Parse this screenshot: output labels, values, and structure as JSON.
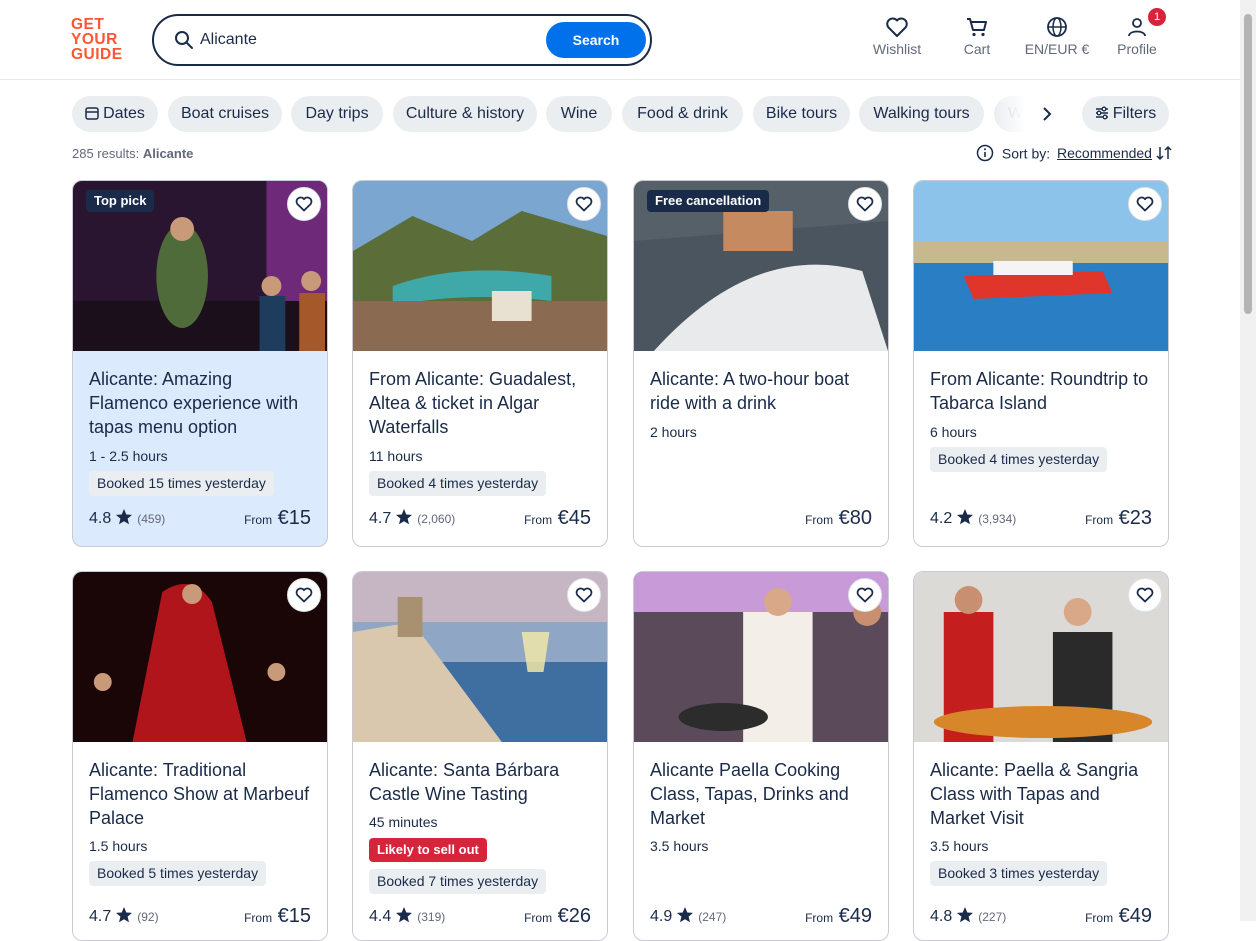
{
  "brand": {
    "line1": "GET",
    "line2": "YOUR",
    "line3": "GUIDE",
    "color": "#ff5533"
  },
  "search": {
    "value": "Alicante",
    "placeholder": "Search",
    "button": "Search"
  },
  "nav": {
    "wishlist": "Wishlist",
    "cart": "Cart",
    "lang": "EN/EUR €",
    "profile": "Profile",
    "profile_badge": "1"
  },
  "chips": [
    "Dates",
    "Boat cruises",
    "Day trips",
    "Culture & history",
    "Wine",
    "Food & drink",
    "Bike tours",
    "Walking tours",
    "W"
  ],
  "filters": "Filters",
  "results": {
    "count": "285 results:",
    "query": "Alicante"
  },
  "sort": {
    "label": "Sort by:",
    "value": "Recommended"
  },
  "cards": [
    {
      "tag": "Top pick",
      "title": "Alicante: Amazing Flamenco experience with tapas menu option",
      "duration": "1 - 2.5 hours",
      "booked": "Booked 15 times yesterday",
      "rating": "4.8",
      "reviews": "(459)",
      "from": "From",
      "price": "€15"
    },
    {
      "tag": "",
      "title": "From Alicante: Guadalest, Altea & ticket in Algar Waterfalls",
      "duration": "11 hours",
      "booked": "Booked 4 times yesterday",
      "rating": "4.7",
      "reviews": "(2,060)",
      "from": "From",
      "price": "€45"
    },
    {
      "tag": "Free cancellation",
      "title": "Alicante: A two-hour boat ride with a drink",
      "duration": "2 hours",
      "booked": "",
      "rating": "",
      "reviews": "",
      "from": "From",
      "price": "€80"
    },
    {
      "tag": "",
      "title": "From Alicante: Roundtrip to Tabarca Island",
      "duration": "6 hours",
      "booked": "Booked 4 times yesterday",
      "rating": "4.2",
      "reviews": "(3,934)",
      "from": "From",
      "price": "€23"
    },
    {
      "tag": "",
      "title": "Alicante: Traditional Flamenco Show at Marbeuf Palace",
      "duration": "1.5 hours",
      "booked": "Booked 5 times yesterday",
      "rating": "4.7",
      "reviews": "(92)",
      "from": "From",
      "price": "€15"
    },
    {
      "tag": "",
      "title": "Alicante: Santa Bárbara Castle Wine Tasting",
      "duration": "45 minutes",
      "sell": "Likely to sell out",
      "booked": "Booked 7 times yesterday",
      "rating": "4.4",
      "reviews": "(319)",
      "from": "From",
      "price": "€26"
    },
    {
      "tag": "",
      "title": "Alicante Paella Cooking Class, Tapas, Drinks and Market",
      "duration": "3.5 hours",
      "booked": "",
      "rating": "4.9",
      "reviews": "(247)",
      "from": "From",
      "price": "€49"
    },
    {
      "tag": "",
      "title": "Alicante: Paella & Sangria Class with Tapas and Market Visit",
      "duration": "3.5 hours",
      "booked": "Booked 3 times yesterday",
      "rating": "4.8",
      "reviews": "(227)",
      "from": "From",
      "price": "€49"
    }
  ],
  "colors": {
    "primary": "#0071eb",
    "text": "#1a2b49",
    "chip": "#ebeef1",
    "alert": "#d6243a"
  }
}
